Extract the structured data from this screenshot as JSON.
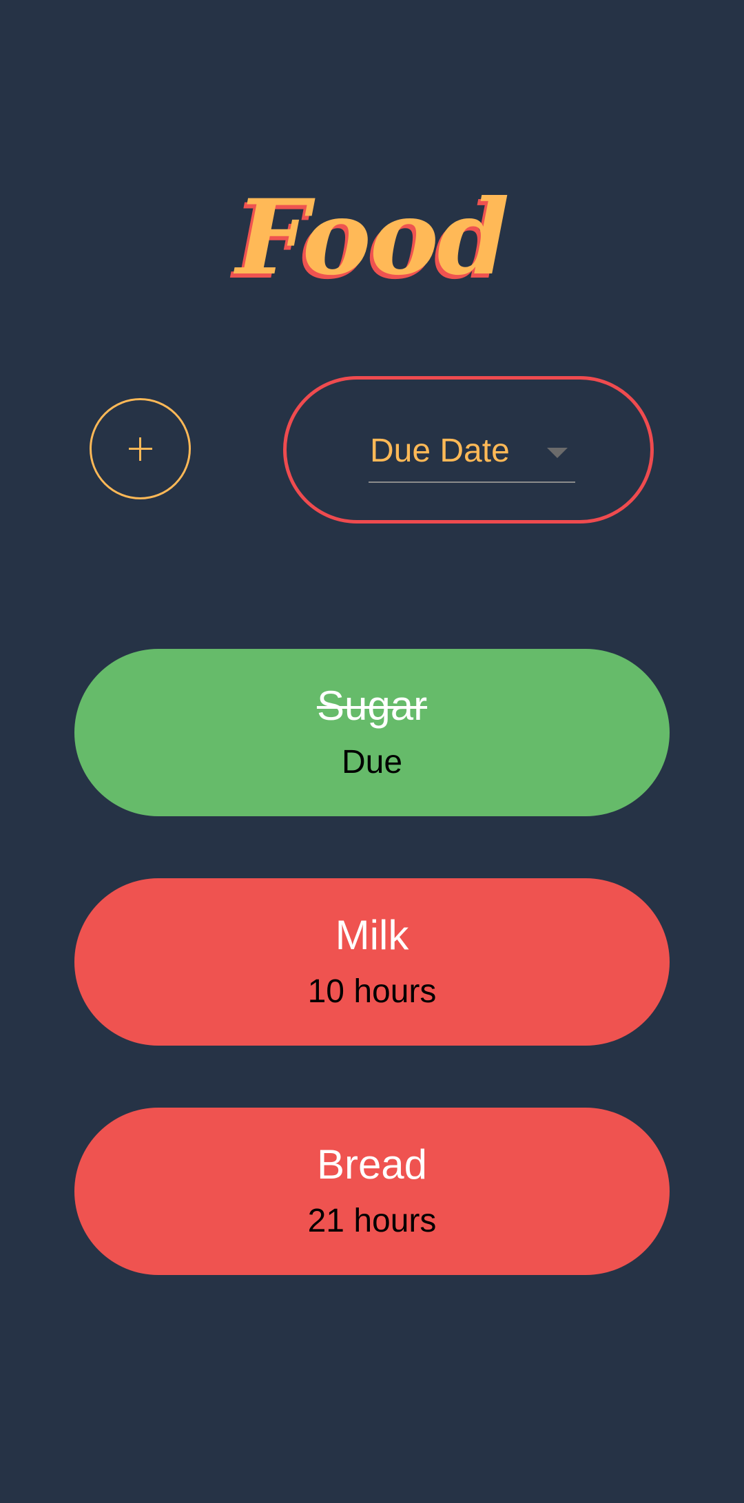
{
  "header": {
    "title": "Food"
  },
  "controls": {
    "add_icon": "plus-icon",
    "sort": {
      "selected": "Due Date",
      "caret_icon": "caret-down-icon"
    }
  },
  "items": [
    {
      "name": "Sugar",
      "due": "Due",
      "status": "completed"
    },
    {
      "name": "Milk",
      "due": "10 hours",
      "status": "pending"
    },
    {
      "name": "Bread",
      "due": "21 hours",
      "status": "pending"
    }
  ],
  "colors": {
    "background": "#263346",
    "accent": "#FFB957",
    "red": "#EF5350",
    "green": "#66BB6A"
  }
}
